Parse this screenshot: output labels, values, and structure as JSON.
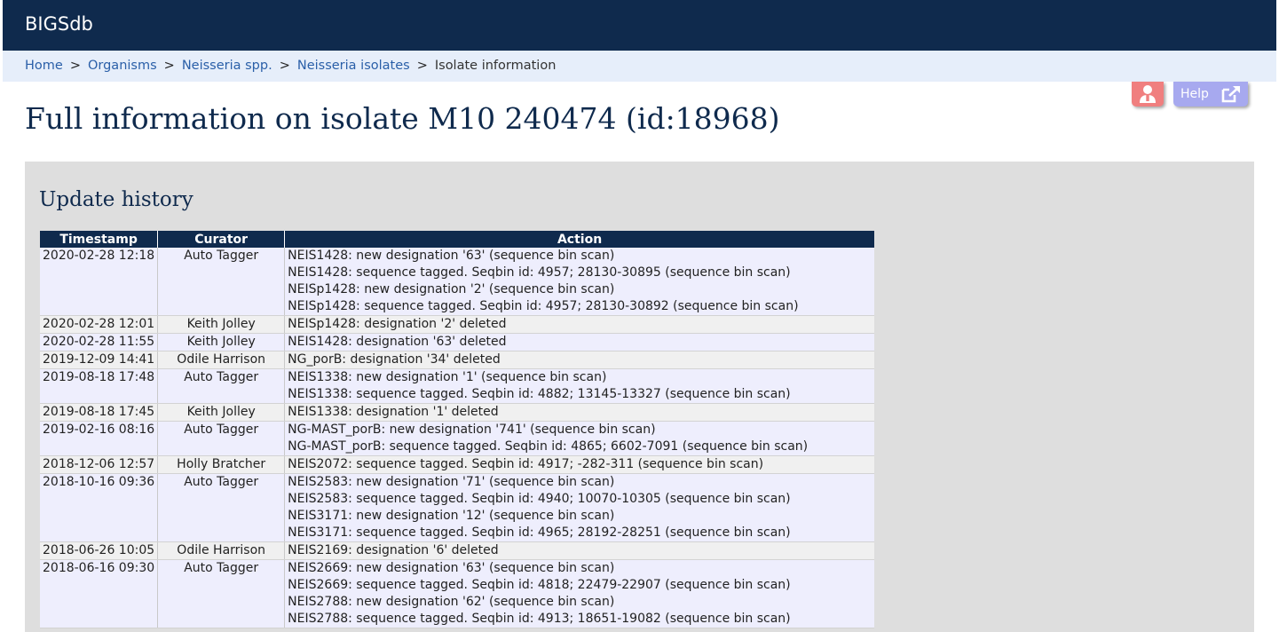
{
  "site": {
    "brand": "BIGSdb"
  },
  "breadcrumb": [
    {
      "label": "Home"
    },
    {
      "label": "Organisms"
    },
    {
      "label": "Neisseria spp."
    },
    {
      "label": "Neisseria isolates"
    }
  ],
  "breadcrumb_current": "Isolate information",
  "breadcrumb_separator": ">",
  "toolbar": {
    "help_label": "Help",
    "user_icon": "user-icon",
    "external_icon": "external-link-icon"
  },
  "colors": {
    "header": "#0f2a4d",
    "user_button": "#f07f7f",
    "help_button": "#a7a9ef"
  },
  "page_title": "Full information on isolate M10 240474 (id:18968)",
  "history": {
    "title": "Update history",
    "columns": [
      "Timestamp",
      "Curator",
      "Action"
    ],
    "rows": [
      {
        "timestamp": "2020-02-28 12:18",
        "curator": "Auto Tagger",
        "actions": [
          "NEIS1428: new designation '63' (sequence bin scan)",
          "NEIS1428: sequence tagged. Seqbin id: 4957; 28130-30895 (sequence bin scan)",
          "NEISp1428: new designation '2' (sequence bin scan)",
          "NEISp1428: sequence tagged. Seqbin id: 4957; 28130-30892 (sequence bin scan)"
        ]
      },
      {
        "timestamp": "2020-02-28 12:01",
        "curator": "Keith Jolley",
        "actions": [
          "NEISp1428: designation '2' deleted"
        ]
      },
      {
        "timestamp": "2020-02-28 11:55",
        "curator": "Keith Jolley",
        "actions": [
          "NEIS1428: designation '63' deleted"
        ]
      },
      {
        "timestamp": "2019-12-09 14:41",
        "curator": "Odile Harrison",
        "actions": [
          "NG_porB: designation '34' deleted"
        ]
      },
      {
        "timestamp": "2019-08-18 17:48",
        "curator": "Auto Tagger",
        "actions": [
          "NEIS1338: new designation '1' (sequence bin scan)",
          "NEIS1338: sequence tagged. Seqbin id: 4882; 13145-13327 (sequence bin scan)"
        ]
      },
      {
        "timestamp": "2019-08-18 17:45",
        "curator": "Keith Jolley",
        "actions": [
          "NEIS1338: designation '1' deleted"
        ]
      },
      {
        "timestamp": "2019-02-16 08:16",
        "curator": "Auto Tagger",
        "actions": [
          "NG-MAST_porB: new designation '741' (sequence bin scan)",
          "NG-MAST_porB: sequence tagged. Seqbin id: 4865; 6602-7091 (sequence bin scan)"
        ]
      },
      {
        "timestamp": "2018-12-06 12:57",
        "curator": "Holly Bratcher",
        "actions": [
          "NEIS2072: sequence tagged. Seqbin id: 4917; -282-311 (sequence bin scan)"
        ]
      },
      {
        "timestamp": "2018-10-16 09:36",
        "curator": "Auto Tagger",
        "actions": [
          "NEIS2583: new designation '71' (sequence bin scan)",
          "NEIS2583: sequence tagged. Seqbin id: 4940; 10070-10305 (sequence bin scan)",
          "NEIS3171: new designation '12' (sequence bin scan)",
          "NEIS3171: sequence tagged. Seqbin id: 4965; 28192-28251 (sequence bin scan)"
        ]
      },
      {
        "timestamp": "2018-06-26 10:05",
        "curator": "Odile Harrison",
        "actions": [
          "NEIS2169: designation '6' deleted"
        ]
      },
      {
        "timestamp": "2018-06-16 09:30",
        "curator": "Auto Tagger",
        "actions": [
          "NEIS2669: new designation '63' (sequence bin scan)",
          "NEIS2669: sequence tagged. Seqbin id: 4818; 22479-22907 (sequence bin scan)",
          "NEIS2788: new designation '62' (sequence bin scan)",
          "NEIS2788: sequence tagged. Seqbin id: 4913; 18651-19082 (sequence bin scan)"
        ]
      }
    ]
  }
}
